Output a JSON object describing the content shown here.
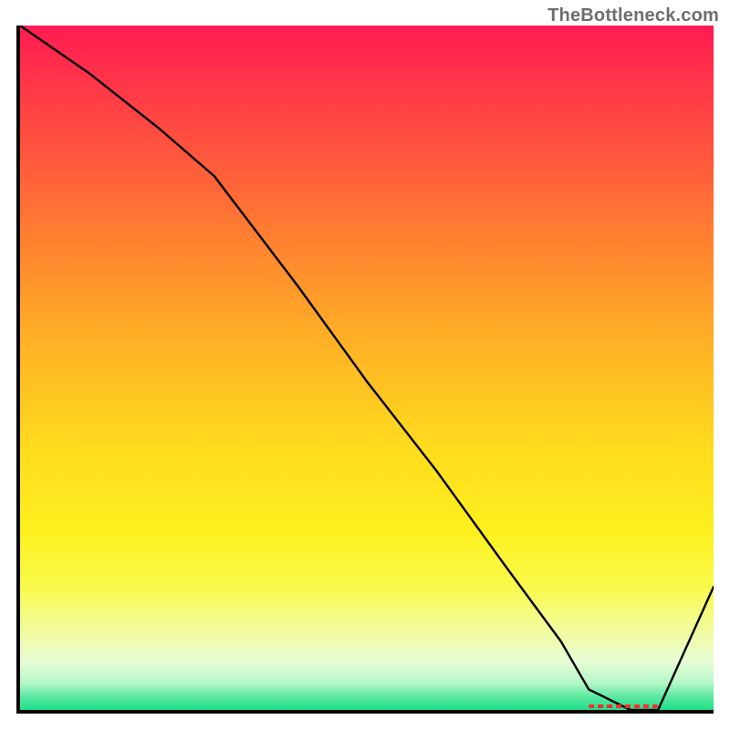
{
  "watermark": "TheBottleneck.com",
  "chart_data": {
    "type": "line",
    "title": "",
    "xlabel": "",
    "ylabel": "",
    "xlim": [
      0,
      100
    ],
    "ylim": [
      0,
      100
    ],
    "x": [
      0,
      10,
      20,
      28,
      40,
      50,
      60,
      70,
      78,
      82,
      88,
      92,
      100
    ],
    "values": [
      100,
      93,
      85,
      78,
      62,
      48,
      35,
      21,
      10,
      3,
      0,
      0,
      18
    ],
    "minimum_band": {
      "x_start": 82,
      "x_end": 92
    },
    "gradient_stops": [
      {
        "pos": 0.0,
        "color": "#ff1b52"
      },
      {
        "pos": 0.5,
        "color": "#ffdc1e"
      },
      {
        "pos": 0.9,
        "color": "#f2fca6"
      },
      {
        "pos": 1.0,
        "color": "#1ee089"
      }
    ]
  }
}
